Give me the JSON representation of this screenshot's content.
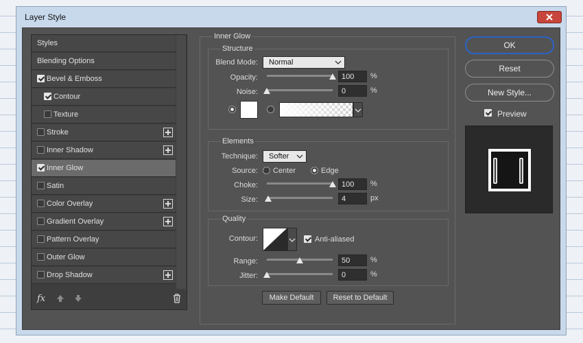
{
  "window": {
    "title": "Layer Style"
  },
  "styles_list": {
    "items": [
      {
        "label": "Styles",
        "has_checkbox": false,
        "checked": false,
        "indent": false,
        "has_plus": false,
        "selected": false
      },
      {
        "label": "Blending Options",
        "has_checkbox": false,
        "checked": false,
        "indent": false,
        "has_plus": false,
        "selected": false
      },
      {
        "label": "Bevel & Emboss",
        "has_checkbox": true,
        "checked": true,
        "indent": false,
        "has_plus": false,
        "selected": false
      },
      {
        "label": "Contour",
        "has_checkbox": true,
        "checked": true,
        "indent": true,
        "has_plus": false,
        "selected": false
      },
      {
        "label": "Texture",
        "has_checkbox": true,
        "checked": false,
        "indent": true,
        "has_plus": false,
        "selected": false
      },
      {
        "label": "Stroke",
        "has_checkbox": true,
        "checked": false,
        "indent": false,
        "has_plus": true,
        "selected": false
      },
      {
        "label": "Inner Shadow",
        "has_checkbox": true,
        "checked": false,
        "indent": false,
        "has_plus": true,
        "selected": false
      },
      {
        "label": "Inner Glow",
        "has_checkbox": true,
        "checked": true,
        "indent": false,
        "has_plus": false,
        "selected": true
      },
      {
        "label": "Satin",
        "has_checkbox": true,
        "checked": false,
        "indent": false,
        "has_plus": false,
        "selected": false
      },
      {
        "label": "Color Overlay",
        "has_checkbox": true,
        "checked": false,
        "indent": false,
        "has_plus": true,
        "selected": false
      },
      {
        "label": "Gradient Overlay",
        "has_checkbox": true,
        "checked": false,
        "indent": false,
        "has_plus": true,
        "selected": false
      },
      {
        "label": "Pattern Overlay",
        "has_checkbox": true,
        "checked": false,
        "indent": false,
        "has_plus": false,
        "selected": false
      },
      {
        "label": "Outer Glow",
        "has_checkbox": true,
        "checked": false,
        "indent": false,
        "has_plus": false,
        "selected": false
      },
      {
        "label": "Drop Shadow",
        "has_checkbox": true,
        "checked": false,
        "indent": false,
        "has_plus": true,
        "selected": false
      }
    ],
    "footer": {
      "fx_label": "fx"
    }
  },
  "inner_glow": {
    "title": "Inner Glow",
    "structure": {
      "title": "Structure",
      "blend_mode_label": "Blend Mode:",
      "blend_mode_value": "Normal",
      "opacity_label": "Opacity:",
      "opacity_value": "100",
      "opacity_unit": "%",
      "opacity_level": 1.0,
      "noise_label": "Noise:",
      "noise_value": "0",
      "noise_unit": "%",
      "noise_level": 0.0,
      "color_mode": "solid",
      "solid_color": "#ffffff"
    },
    "elements": {
      "title": "Elements",
      "technique_label": "Technique:",
      "technique_value": "Softer",
      "source_label": "Source:",
      "source_center": "Center",
      "source_edge": "Edge",
      "source_selected": "edge",
      "choke_label": "Choke:",
      "choke_value": "100",
      "choke_unit": "%",
      "choke_level": 1.0,
      "size_label": "Size:",
      "size_value": "4",
      "size_unit": "px",
      "size_level": 0.016
    },
    "quality": {
      "title": "Quality",
      "contour_label": "Contour:",
      "anti_aliased_label": "Anti-aliased",
      "anti_aliased_checked": true,
      "range_label": "Range:",
      "range_value": "50",
      "range_unit": "%",
      "range_level": 0.5,
      "jitter_label": "Jitter:",
      "jitter_value": "0",
      "jitter_unit": "%",
      "jitter_level": 0.0
    },
    "make_default_label": "Make Default",
    "reset_default_label": "Reset to Default"
  },
  "actions": {
    "ok_label": "OK",
    "reset_label": "Reset",
    "new_style_label": "New Style...",
    "preview_label": "Preview",
    "preview_checked": true
  },
  "colors": {
    "panel_bg": "#535353",
    "ok_border": "#2b63c7",
    "close_button": "#c8453b"
  }
}
